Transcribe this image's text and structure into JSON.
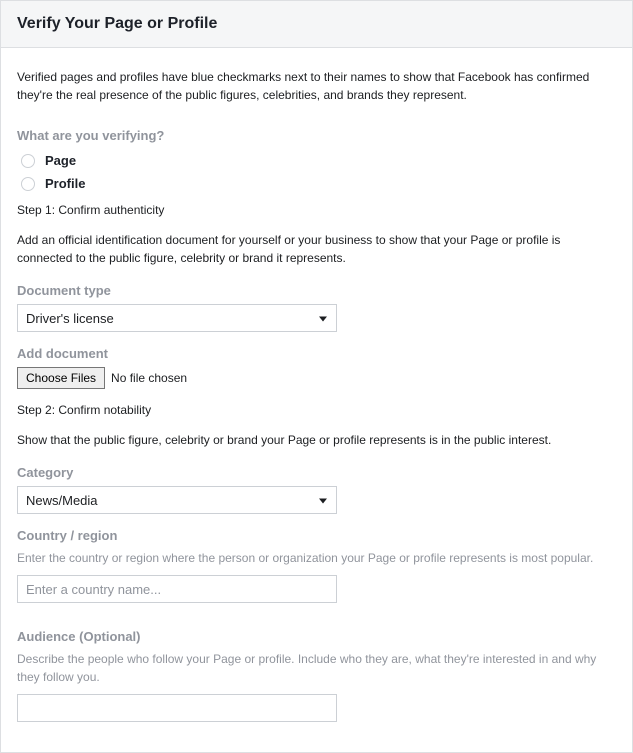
{
  "header": {
    "title": "Verify Your Page or Profile"
  },
  "intro": "Verified pages and profiles have blue checkmarks next to their names to show that Facebook has confirmed they're the real presence of the public figures, celebrities, and brands they represent.",
  "verifying": {
    "question": "What are you verifying?",
    "options": {
      "page": "Page",
      "profile": "Profile"
    }
  },
  "step1": {
    "title": "Step 1: Confirm authenticity",
    "desc": "Add an official identification document for yourself or your business to show that your Page or profile is connected to the public figure, celebrity or brand it represents."
  },
  "documentType": {
    "label": "Document type",
    "value": "Driver's license"
  },
  "addDocument": {
    "label": "Add document",
    "button": "Choose Files",
    "status": "No file chosen"
  },
  "step2": {
    "title": "Step 2: Confirm notability",
    "desc": "Show that the public figure, celebrity or brand your Page or profile represents is in the public interest."
  },
  "category": {
    "label": "Category",
    "value": "News/Media"
  },
  "country": {
    "label": "Country / region",
    "help": "Enter the country or region where the person or organization your Page or profile represents is most popular.",
    "placeholder": "Enter a country name..."
  },
  "audience": {
    "label": "Audience (Optional)",
    "help": "Describe the people who follow your Page or profile. Include who they are, what they're interested in and why they follow you."
  }
}
